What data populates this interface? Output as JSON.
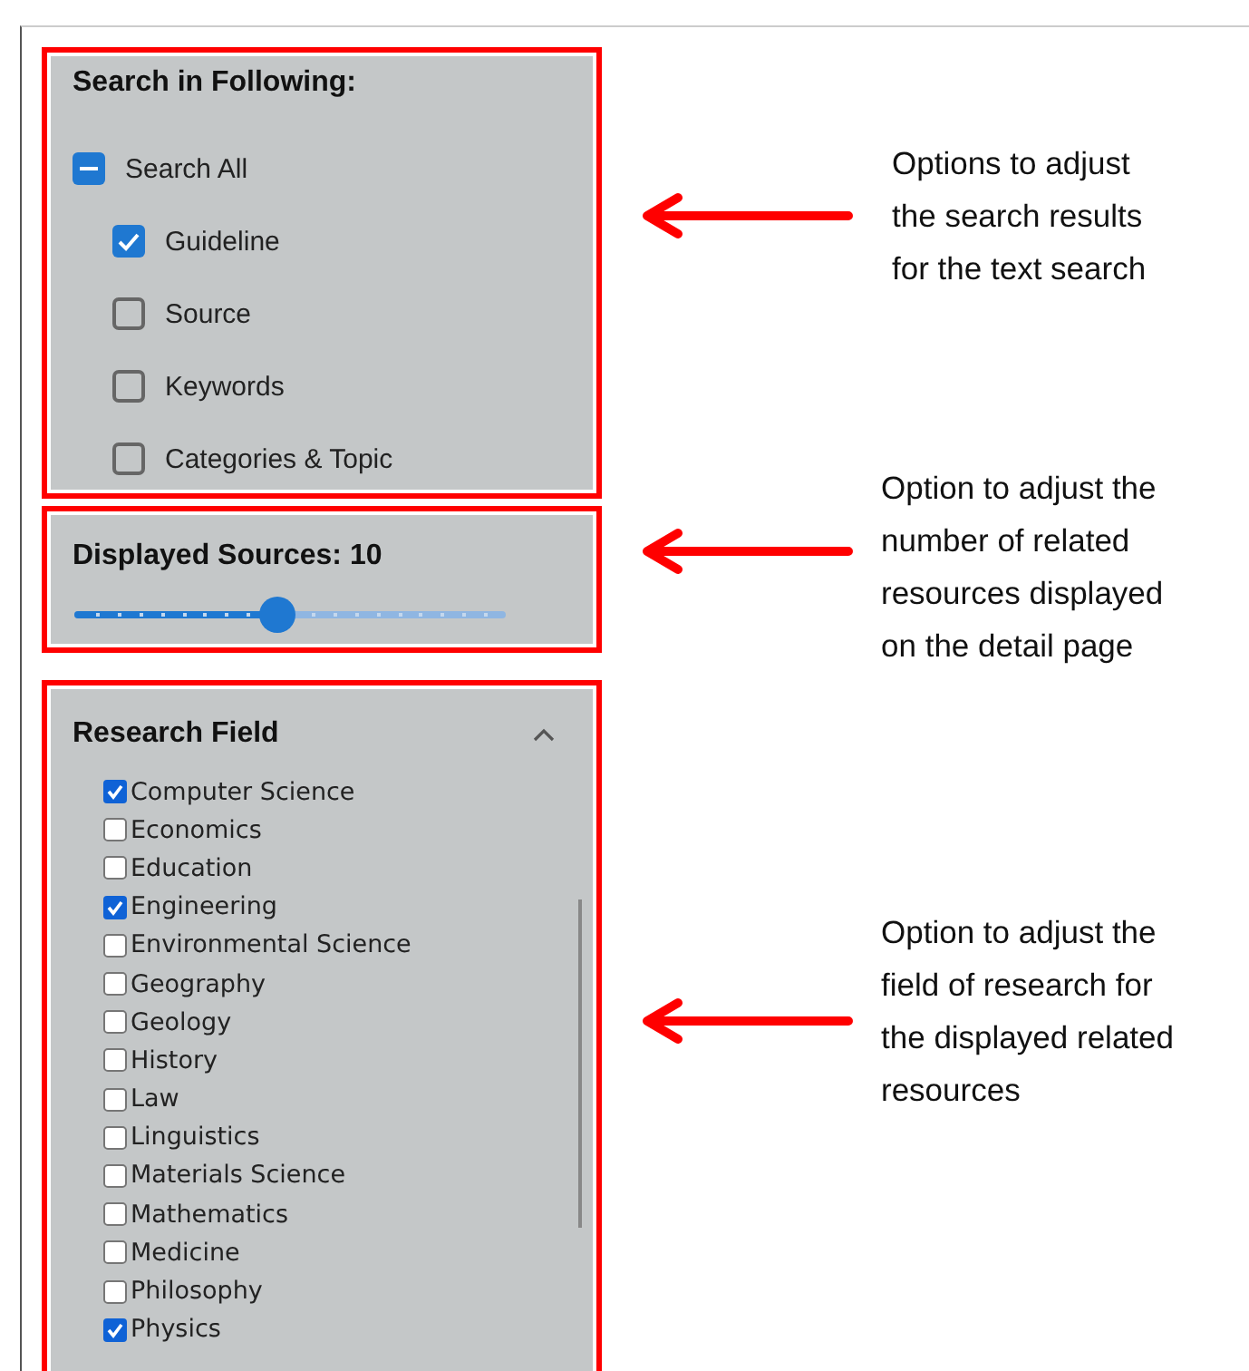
{
  "search_panel": {
    "title": "Search in Following:",
    "select_all": {
      "label": "Search All",
      "checked": false,
      "indeterminate": true
    },
    "options": [
      {
        "label": "Guideline",
        "checked": true
      },
      {
        "label": "Source",
        "checked": false
      },
      {
        "label": "Keywords",
        "checked": false
      },
      {
        "label": "Categories & Topic",
        "checked": false
      }
    ]
  },
  "sources_panel": {
    "title": "Displayed Sources: 10",
    "slider": {
      "level": 0.47
    }
  },
  "research_panel": {
    "title": "Research Field",
    "expanded": true,
    "fields": [
      {
        "label": "Computer Science",
        "checked": true
      },
      {
        "label": "Economics",
        "checked": false
      },
      {
        "label": "Education",
        "checked": false
      },
      {
        "label": "Engineering",
        "checked": true
      },
      {
        "label": "Environmental Science",
        "checked": false
      },
      {
        "label": "Geography",
        "checked": false
      },
      {
        "label": "Geology",
        "checked": false
      },
      {
        "label": "History",
        "checked": false
      },
      {
        "label": "Law",
        "checked": false
      },
      {
        "label": "Linguistics",
        "checked": false
      },
      {
        "label": "Materials Science",
        "checked": false
      },
      {
        "label": "Mathematics",
        "checked": false
      },
      {
        "label": "Medicine",
        "checked": false
      },
      {
        "label": "Philosophy",
        "checked": false
      },
      {
        "label": "Physics",
        "checked": true
      }
    ]
  },
  "annotations": [
    {
      "lines": [
        "Options to adjust",
        "the search results",
        "for the text search"
      ]
    },
    {
      "lines": [
        "Option to adjust the",
        "number of related",
        "resources displayed",
        "on the detail page"
      ]
    },
    {
      "lines": [
        "Option to adjust the",
        "field of research for",
        "the displayed related",
        "resources"
      ]
    }
  ]
}
